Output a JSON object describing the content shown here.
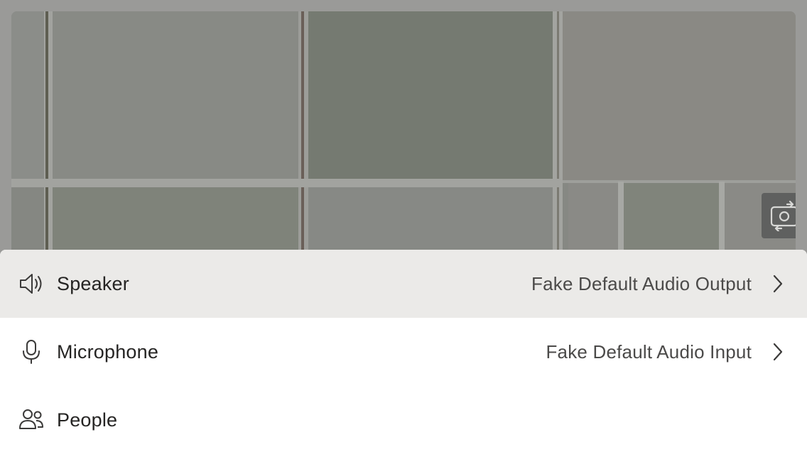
{
  "preview": {
    "label": "",
    "switch_camera_icon": "switch-camera-icon"
  },
  "menu": {
    "items": [
      {
        "label": "Speaker",
        "value": "Fake Default Audio Output",
        "icon": "speaker-icon",
        "has_chevron": true
      },
      {
        "label": "Microphone",
        "value": "Fake Default Audio Input",
        "icon": "microphone-icon",
        "has_chevron": true
      },
      {
        "label": "People",
        "value": "",
        "icon": "people-icon",
        "has_chevron": false
      }
    ]
  },
  "colors": {
    "sheet_background": "#ffffff",
    "highlight_row": "#ebeae8",
    "label_text": "#252423",
    "value_text": "#4b4a49",
    "switch_button": "#5f605f"
  }
}
